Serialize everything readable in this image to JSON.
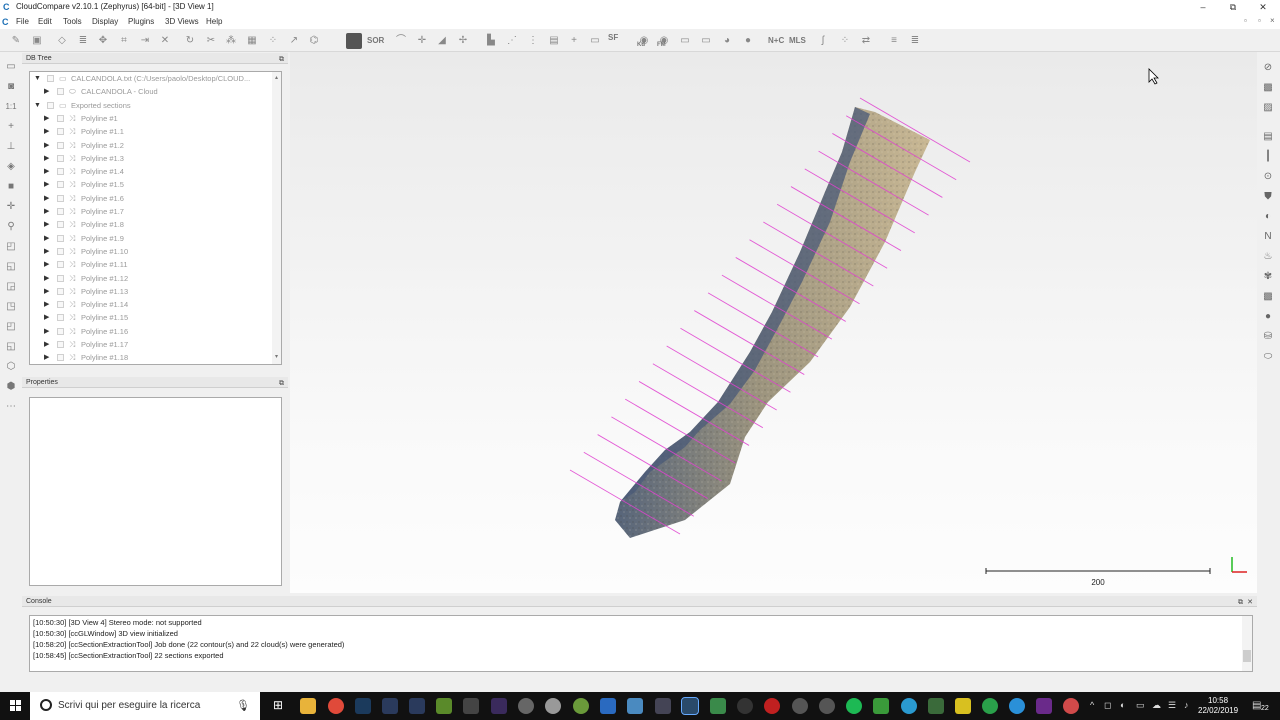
{
  "window": {
    "title": "CloudCompare v2.10.1 (Zephyrus) [64-bit] - [3D View 1]",
    "minimize": "–",
    "restore": "⧉",
    "close": "✕"
  },
  "menu": [
    "File",
    "Edit",
    "Tools",
    "Display",
    "Plugins",
    "3D Views",
    "Help"
  ],
  "toolbar": {
    "sor_label": "SOR",
    "sf_label": "SF",
    "nc_label": "N+C",
    "mls_label": "MLS",
    "kd_label": "Kd",
    "fm_label": "FM"
  },
  "db_tree": {
    "title": "DB Tree",
    "items": [
      {
        "label": "CALCANDOLA.txt (C:/Users/paolo/Desktop/CLOUD...",
        "level": 0,
        "expanded": true,
        "icon": "folder-icon"
      },
      {
        "label": "CALCANDOLA - Cloud",
        "level": 1,
        "expanded": false,
        "icon": "cloud-icon"
      },
      {
        "label": "Exported sections",
        "level": 0,
        "expanded": true,
        "icon": "folder-icon"
      },
      {
        "label": "Polyline #1",
        "level": 1,
        "icon": "polyline-icon"
      },
      {
        "label": "Polyline #1.1",
        "level": 1,
        "icon": "polyline-icon"
      },
      {
        "label": "Polyline #1.2",
        "level": 1,
        "icon": "polyline-icon"
      },
      {
        "label": "Polyline #1.3",
        "level": 1,
        "icon": "polyline-icon"
      },
      {
        "label": "Polyline #1.4",
        "level": 1,
        "icon": "polyline-icon"
      },
      {
        "label": "Polyline #1.5",
        "level": 1,
        "icon": "polyline-icon"
      },
      {
        "label": "Polyline #1.6",
        "level": 1,
        "icon": "polyline-icon"
      },
      {
        "label": "Polyline #1.7",
        "level": 1,
        "icon": "polyline-icon"
      },
      {
        "label": "Polyline #1.8",
        "level": 1,
        "icon": "polyline-icon"
      },
      {
        "label": "Polyline #1.9",
        "level": 1,
        "icon": "polyline-icon"
      },
      {
        "label": "Polyline #1.10",
        "level": 1,
        "icon": "polyline-icon"
      },
      {
        "label": "Polyline #1.11",
        "level": 1,
        "icon": "polyline-icon"
      },
      {
        "label": "Polyline #1.12",
        "level": 1,
        "icon": "polyline-icon"
      },
      {
        "label": "Polyline #1.13",
        "level": 1,
        "icon": "polyline-icon"
      },
      {
        "label": "Polyline #1.14",
        "level": 1,
        "icon": "polyline-icon"
      },
      {
        "label": "Polyline #1.15",
        "level": 1,
        "icon": "polyline-icon"
      },
      {
        "label": "Polyline #1.16",
        "level": 1,
        "icon": "polyline-icon"
      },
      {
        "label": "Polyline #1.17",
        "level": 1,
        "icon": "polyline-icon"
      },
      {
        "label": "Polyline #1.18",
        "level": 1,
        "icon": "polyline-icon"
      }
    ]
  },
  "properties": {
    "title": "Properties"
  },
  "view3d": {
    "scale_label": "200",
    "cloud_color": "#b8a98a",
    "section_color": "#e040d0",
    "section_count": 22
  },
  "console": {
    "title": "Console",
    "lines": [
      "[10:50:30] [3D View 4] Stereo mode: not supported",
      "[10:50:30] [ccGLWindow] 3D view initialized",
      "[10:58:20] [ccSectionExtractionTool] Job done (22 contour(s) and 22 cloud(s) were generated)",
      "[10:58:45] [ccSectionExtractionTool] 22 sections exported"
    ]
  },
  "taskbar": {
    "search_placeholder": "Scrivi qui per eseguire la ricerca",
    "time": "10:58",
    "date": "22/02/2019",
    "notification_count": "22"
  }
}
